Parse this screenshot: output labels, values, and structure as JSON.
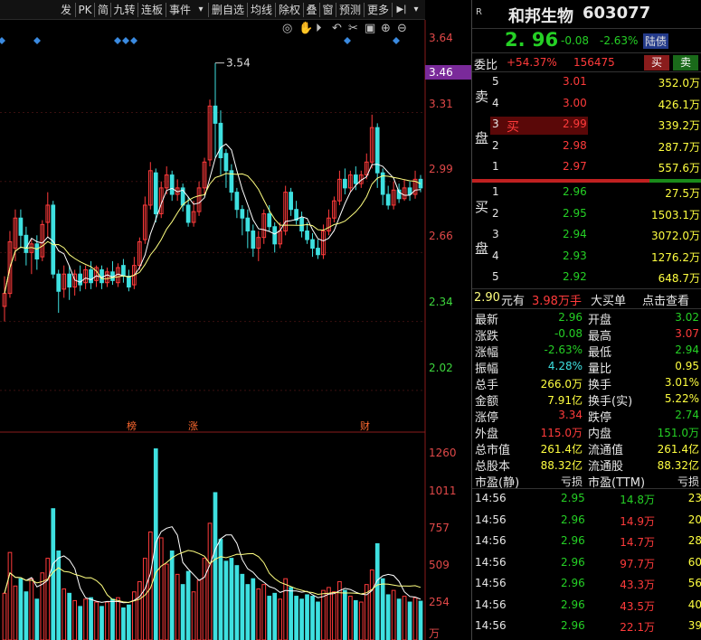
{
  "toolbar": {
    "items": [
      "发",
      "PK",
      "简",
      "九转",
      "连板",
      "事件",
      "▾",
      "删自选",
      "均线",
      "除权",
      "叠",
      "窗",
      "预测",
      "更多"
    ],
    "end_icon": "▶|",
    "dropdown": "▾"
  },
  "chart_tools": [
    "eye-icon",
    "hand-icon",
    "play-icon",
    "undo-icon",
    "scissors-icon",
    "lock-icon",
    "zoom-in-icon",
    "zoom-out-icon"
  ],
  "price_axis": [
    "3.64",
    "3.46",
    "3.31",
    "2.99",
    "2.66",
    "2.34",
    "2.02"
  ],
  "high_marker": "3.54",
  "event_marks": [
    "榜",
    "涨",
    "财"
  ],
  "volume_axis": [
    "1260",
    "1011",
    "757",
    "509",
    "254",
    "万"
  ],
  "colors": {
    "up": "#ff3b3b",
    "down": "#3ee0e0",
    "ma5": "#ffffff",
    "ma10": "#ffff80",
    "axis_highlight": "#7a2a9a"
  },
  "chart_data": {
    "type": "candlestick",
    "price_ylim": [
      1.86,
      3.74
    ],
    "volume_ylim": [
      0,
      1400
    ],
    "candles": [
      {
        "o": 2.41,
        "c": 2.47,
        "h": 2.55,
        "l": 2.34,
        "v": 320
      },
      {
        "o": 2.47,
        "c": 2.71,
        "h": 2.76,
        "l": 2.45,
        "v": 600
      },
      {
        "o": 2.68,
        "c": 2.82,
        "h": 2.86,
        "l": 2.62,
        "v": 370
      },
      {
        "o": 2.82,
        "c": 2.74,
        "h": 2.86,
        "l": 2.68,
        "v": 420
      },
      {
        "o": 2.74,
        "c": 2.66,
        "h": 2.78,
        "l": 2.6,
        "v": 330
      },
      {
        "o": 2.66,
        "c": 2.7,
        "h": 2.72,
        "l": 2.56,
        "v": 420
      },
      {
        "o": 2.7,
        "c": 2.63,
        "h": 2.74,
        "l": 2.58,
        "v": 280
      },
      {
        "o": 2.64,
        "c": 2.79,
        "h": 2.81,
        "l": 2.62,
        "v": 460
      },
      {
        "o": 2.8,
        "c": 2.88,
        "h": 2.94,
        "l": 2.73,
        "v": 560
      },
      {
        "o": 2.88,
        "c": 2.56,
        "h": 2.9,
        "l": 2.54,
        "v": 900
      },
      {
        "o": 2.56,
        "c": 2.48,
        "h": 2.58,
        "l": 2.38,
        "v": 610
      },
      {
        "o": 2.49,
        "c": 2.56,
        "h": 2.6,
        "l": 2.45,
        "v": 350
      },
      {
        "o": 2.56,
        "c": 2.5,
        "h": 2.6,
        "l": 2.44,
        "v": 320
      },
      {
        "o": 2.5,
        "c": 2.56,
        "h": 2.58,
        "l": 2.46,
        "v": 270
      },
      {
        "o": 2.56,
        "c": 2.51,
        "h": 2.6,
        "l": 2.48,
        "v": 230
      },
      {
        "o": 2.52,
        "c": 2.58,
        "h": 2.6,
        "l": 2.49,
        "v": 280
      },
      {
        "o": 2.58,
        "c": 2.52,
        "h": 2.62,
        "l": 2.49,
        "v": 290
      },
      {
        "o": 2.53,
        "c": 2.59,
        "h": 2.6,
        "l": 2.5,
        "v": 260
      },
      {
        "o": 2.58,
        "c": 2.52,
        "h": 2.6,
        "l": 2.49,
        "v": 230
      },
      {
        "o": 2.52,
        "c": 2.57,
        "h": 2.59,
        "l": 2.5,
        "v": 260
      },
      {
        "o": 2.57,
        "c": 2.53,
        "h": 2.62,
        "l": 2.51,
        "v": 280
      },
      {
        "o": 2.52,
        "c": 2.59,
        "h": 2.61,
        "l": 2.5,
        "v": 290
      },
      {
        "o": 2.6,
        "c": 2.55,
        "h": 2.63,
        "l": 2.52,
        "v": 220
      },
      {
        "o": 2.55,
        "c": 2.5,
        "h": 2.58,
        "l": 2.48,
        "v": 240
      },
      {
        "o": 2.51,
        "c": 2.6,
        "h": 2.64,
        "l": 2.49,
        "v": 330
      },
      {
        "o": 2.6,
        "c": 2.71,
        "h": 2.73,
        "l": 2.58,
        "v": 400
      },
      {
        "o": 2.72,
        "c": 2.88,
        "h": 2.92,
        "l": 2.7,
        "v": 560
      },
      {
        "o": 2.88,
        "c": 3.04,
        "h": 3.08,
        "l": 2.86,
        "v": 740
      },
      {
        "o": 3.03,
        "c": 2.84,
        "h": 3.05,
        "l": 2.8,
        "v": 1310
      },
      {
        "o": 2.84,
        "c": 2.96,
        "h": 2.99,
        "l": 2.82,
        "v": 700
      },
      {
        "o": 2.96,
        "c": 3.02,
        "h": 3.06,
        "l": 2.93,
        "v": 520
      },
      {
        "o": 3.02,
        "c": 2.93,
        "h": 3.04,
        "l": 2.9,
        "v": 610
      },
      {
        "o": 2.93,
        "c": 2.96,
        "h": 3.0,
        "l": 2.9,
        "v": 450
      },
      {
        "o": 2.96,
        "c": 2.88,
        "h": 2.98,
        "l": 2.85,
        "v": 380
      },
      {
        "o": 2.88,
        "c": 2.8,
        "h": 2.92,
        "l": 2.78,
        "v": 470
      },
      {
        "o": 2.8,
        "c": 2.85,
        "h": 2.9,
        "l": 2.78,
        "v": 330
      },
      {
        "o": 2.85,
        "c": 2.96,
        "h": 2.99,
        "l": 2.83,
        "v": 410
      },
      {
        "o": 2.96,
        "c": 3.08,
        "h": 3.1,
        "l": 2.93,
        "v": 560
      },
      {
        "o": 3.09,
        "c": 3.34,
        "h": 3.37,
        "l": 3.06,
        "v": 800
      },
      {
        "o": 3.34,
        "c": 3.26,
        "h": 3.54,
        "l": 3.1,
        "v": 1010
      },
      {
        "o": 3.26,
        "c": 3.1,
        "h": 3.32,
        "l": 3.02,
        "v": 690
      },
      {
        "o": 3.12,
        "c": 3.04,
        "h": 3.14,
        "l": 2.96,
        "v": 540
      },
      {
        "o": 3.04,
        "c": 2.94,
        "h": 3.07,
        "l": 2.9,
        "v": 560
      },
      {
        "o": 2.94,
        "c": 2.86,
        "h": 2.96,
        "l": 2.82,
        "v": 510
      },
      {
        "o": 2.86,
        "c": 2.82,
        "h": 2.88,
        "l": 2.74,
        "v": 450
      },
      {
        "o": 2.82,
        "c": 2.76,
        "h": 2.86,
        "l": 2.68,
        "v": 380
      },
      {
        "o": 2.76,
        "c": 2.68,
        "h": 2.79,
        "l": 2.64,
        "v": 420
      },
      {
        "o": 2.68,
        "c": 2.73,
        "h": 2.76,
        "l": 2.62,
        "v": 350
      },
      {
        "o": 2.73,
        "c": 2.84,
        "h": 2.86,
        "l": 2.7,
        "v": 380
      },
      {
        "o": 2.84,
        "c": 2.78,
        "h": 2.88,
        "l": 2.76,
        "v": 300
      },
      {
        "o": 2.78,
        "c": 2.7,
        "h": 2.8,
        "l": 2.66,
        "v": 320
      },
      {
        "o": 2.7,
        "c": 2.76,
        "h": 2.8,
        "l": 2.68,
        "v": 280
      },
      {
        "o": 2.76,
        "c": 2.94,
        "h": 2.97,
        "l": 2.74,
        "v": 420
      },
      {
        "o": 2.94,
        "c": 2.86,
        "h": 2.96,
        "l": 2.83,
        "v": 360
      },
      {
        "o": 2.86,
        "c": 2.81,
        "h": 2.9,
        "l": 2.79,
        "v": 300
      },
      {
        "o": 2.82,
        "c": 2.76,
        "h": 2.85,
        "l": 2.73,
        "v": 280
      },
      {
        "o": 2.76,
        "c": 2.72,
        "h": 2.8,
        "l": 2.7,
        "v": 310
      },
      {
        "o": 2.72,
        "c": 2.68,
        "h": 2.75,
        "l": 2.64,
        "v": 300
      },
      {
        "o": 2.68,
        "c": 2.65,
        "h": 2.72,
        "l": 2.63,
        "v": 260
      },
      {
        "o": 2.65,
        "c": 2.76,
        "h": 2.79,
        "l": 2.63,
        "v": 340
      },
      {
        "o": 2.76,
        "c": 2.82,
        "h": 2.86,
        "l": 2.74,
        "v": 360
      },
      {
        "o": 2.82,
        "c": 2.9,
        "h": 2.92,
        "l": 2.8,
        "v": 330
      },
      {
        "o": 2.9,
        "c": 3.0,
        "h": 3.04,
        "l": 2.88,
        "v": 400
      },
      {
        "o": 3.0,
        "c": 2.96,
        "h": 3.05,
        "l": 2.93,
        "v": 340
      },
      {
        "o": 2.96,
        "c": 3.02,
        "h": 3.04,
        "l": 2.94,
        "v": 300
      },
      {
        "o": 3.02,
        "c": 2.98,
        "h": 3.06,
        "l": 2.95,
        "v": 270
      },
      {
        "o": 2.98,
        "c": 3.02,
        "h": 3.04,
        "l": 2.96,
        "v": 260
      },
      {
        "o": 3.02,
        "c": 3.08,
        "h": 3.12,
        "l": 3.0,
        "v": 380
      },
      {
        "o": 3.08,
        "c": 3.24,
        "h": 3.3,
        "l": 3.05,
        "v": 480
      },
      {
        "o": 3.24,
        "c": 3.03,
        "h": 3.26,
        "l": 2.96,
        "v": 660
      },
      {
        "o": 3.03,
        "c": 2.93,
        "h": 3.05,
        "l": 2.88,
        "v": 420
      },
      {
        "o": 2.93,
        "c": 2.88,
        "h": 2.97,
        "l": 2.86,
        "v": 310
      },
      {
        "o": 2.88,
        "c": 2.95,
        "h": 2.99,
        "l": 2.86,
        "v": 340
      },
      {
        "o": 2.95,
        "c": 2.91,
        "h": 2.98,
        "l": 2.89,
        "v": 280
      },
      {
        "o": 2.91,
        "c": 2.96,
        "h": 3.0,
        "l": 2.9,
        "v": 300
      },
      {
        "o": 2.96,
        "c": 2.93,
        "h": 2.99,
        "l": 2.9,
        "v": 260
      },
      {
        "o": 2.93,
        "c": 3.0,
        "h": 3.04,
        "l": 2.91,
        "v": 290
      },
      {
        "o": 3.0,
        "c": 2.96,
        "h": 3.02,
        "l": 2.94,
        "v": 266
      }
    ]
  },
  "quote": {
    "badge": "R",
    "name": "和邦生物",
    "code": "603077",
    "price": "2. 96",
    "change": "-0.08",
    "pct": "-2.63%",
    "tag": "陆债"
  },
  "commission": {
    "label": "委比",
    "ratio": "+54.37%",
    "diff": "156475",
    "buy_btn": "买",
    "sell_btn": "卖"
  },
  "sell_label": [
    "卖",
    "盘"
  ],
  "sells": [
    {
      "n": "5",
      "p": "3.01",
      "q": "352.0万"
    },
    {
      "n": "4",
      "p": "3.00",
      "q": "426.1万"
    },
    {
      "n": "3",
      "p": "2.99",
      "q": "339.2万",
      "tag": "买"
    },
    {
      "n": "2",
      "p": "2.98",
      "q": "287.7万"
    },
    {
      "n": "1",
      "p": "2.97",
      "q": "557.6万"
    }
  ],
  "buy_label": [
    "买",
    "盘"
  ],
  "buys": [
    {
      "n": "1",
      "p": "2.96",
      "q": "27.5万"
    },
    {
      "n": "2",
      "p": "2.95",
      "q": "1503.1万"
    },
    {
      "n": "3",
      "p": "2.94",
      "q": "3072.0万"
    },
    {
      "n": "4",
      "p": "2.93",
      "q": "1276.2万"
    },
    {
      "n": "5",
      "p": "2.92",
      "q": "648.7万"
    }
  ],
  "bigorder": {
    "price": "2.90",
    "unit1": "元有",
    "amount": "3.98万手",
    "title": "大买单",
    "link": "点击查看"
  },
  "stats": [
    {
      "l": "最新",
      "v": "2.96",
      "vc": "green",
      "l2": "开盘",
      "v2": "3.02",
      "v2c": "green"
    },
    {
      "l": "涨跌",
      "v": "-0.08",
      "vc": "green",
      "l2": "最高",
      "v2": "3.07",
      "v2c": "red"
    },
    {
      "l": "涨幅",
      "v": "-2.63%",
      "vc": "green",
      "l2": "最低",
      "v2": "2.94",
      "v2c": "green"
    },
    {
      "l": "振幅",
      "v": "4.28%",
      "vc": "cyan",
      "l2": "量比",
      "v2": "0.95",
      "v2c": "yellow"
    },
    {
      "l": "总手",
      "v": "266.0万",
      "vc": "yellow",
      "l2": "换手",
      "v2": "3.01%",
      "v2c": "yellow"
    },
    {
      "l": "金额",
      "v": "7.91亿",
      "vc": "yellow",
      "l2": "换手(实)",
      "v2": "5.22%",
      "v2c": "yellow"
    },
    {
      "l": "涨停",
      "v": "3.34",
      "vc": "red",
      "l2": "跌停",
      "v2": "2.74",
      "v2c": "green"
    },
    {
      "l": "外盘",
      "v": "115.0万",
      "vc": "red",
      "l2": "内盘",
      "v2": "151.0万",
      "v2c": "green"
    },
    {
      "l": "总市值",
      "v": "261.4亿",
      "vc": "yellow",
      "l2": "流通值",
      "v2": "261.4亿",
      "v2c": "yellow"
    },
    {
      "l": "总股本",
      "v": "88.32亿",
      "vc": "yellow",
      "l2": "流通股",
      "v2": "88.32亿",
      "v2c": "yellow"
    },
    {
      "l": "市盈(静)",
      "v": "亏损",
      "vc": "white",
      "l2": "市盈(TTM)",
      "v2": "亏损",
      "v2c": "white"
    }
  ],
  "ticks": [
    {
      "t": "14:56",
      "p": "2.95",
      "v": "14.8万",
      "vc": "green",
      "n": "23"
    },
    {
      "t": "14:56",
      "p": "2.96",
      "v": "14.9万",
      "vc": "red",
      "n": "20"
    },
    {
      "t": "14:56",
      "p": "2.96",
      "v": "14.7万",
      "vc": "red",
      "n": "28"
    },
    {
      "t": "14:56",
      "p": "2.96",
      "v": "97.7万",
      "vc": "red",
      "n": "60"
    },
    {
      "t": "14:56",
      "p": "2.96",
      "v": "43.3万",
      "vc": "red",
      "n": "56"
    },
    {
      "t": "14:56",
      "p": "2.96",
      "v": "43.5万",
      "vc": "red",
      "n": "40"
    },
    {
      "t": "14:56",
      "p": "2.96",
      "v": "22.1万",
      "vc": "red",
      "n": "39"
    }
  ]
}
